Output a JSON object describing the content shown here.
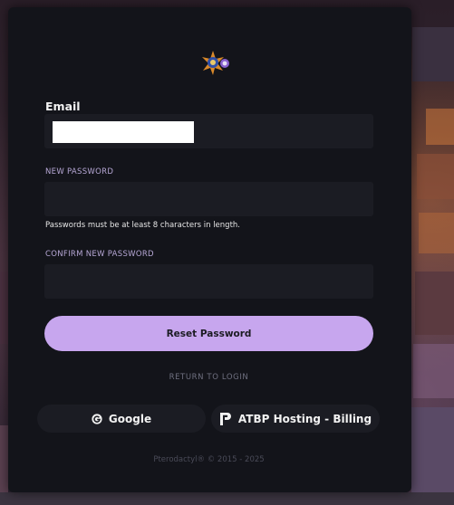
{
  "form": {
    "email_label": "Email",
    "new_password_label": "NEW PASSWORD",
    "new_password_hint": "Passwords must be at least 8 characters in length.",
    "confirm_password_label": "CONFIRM NEW PASSWORD",
    "reset_button": "Reset Password",
    "return_link": "RETURN TO LOGIN"
  },
  "oauth": {
    "google_label": "Google",
    "google_icon": "google-icon",
    "billing_label": "ATBP Hosting - Billing",
    "billing_icon": "paymenter-icon"
  },
  "footer": {
    "text": "Pterodactyl® © 2015 - 2025"
  },
  "colors": {
    "card_bg": "#13141a",
    "input_bg": "#1b1c23",
    "accent": "#c7a6ee",
    "label_accent": "#b7a8d6"
  }
}
